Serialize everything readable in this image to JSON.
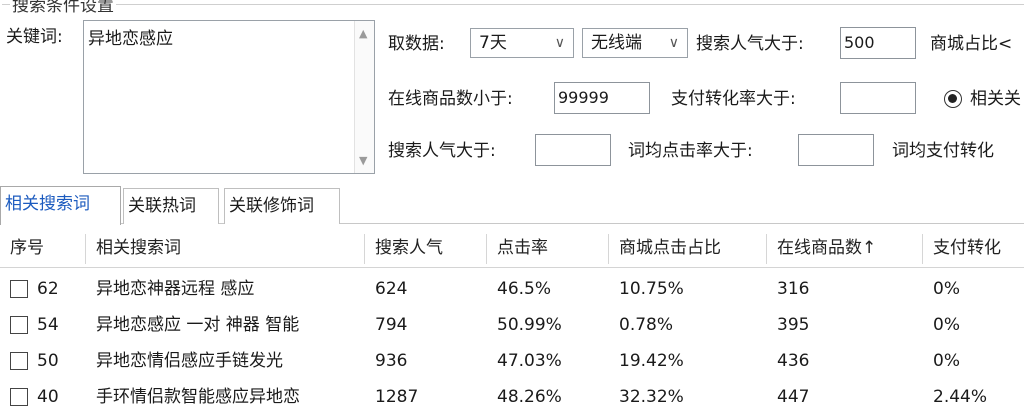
{
  "group_title": "搜索条件设置",
  "keyword": {
    "label": "关键词:",
    "value": "异地恋感应"
  },
  "filters": {
    "period_label": "取数据:",
    "period_value": "7天",
    "terminal_value": "无线端",
    "popularity_label": "搜索人气大于:",
    "popularity_value": "500",
    "mall_label": "商城占比<",
    "online_goods_label": "在线商品数小于:",
    "online_goods_value": "99999",
    "pay_rate_label": "支付转化率大于:",
    "pay_rate_value": "",
    "related_radio_label": "相关关",
    "popularity2_label": "搜索人气大于:",
    "popularity2_value": "",
    "avg_ctr_label": "词均点击率大于:",
    "avg_ctr_value": "",
    "avg_pay_label": "词均支付转化"
  },
  "tabs": [
    "相关搜索词",
    "关联热词",
    "关联修饰词"
  ],
  "table": {
    "headers": [
      "序号",
      "相关搜索词",
      "搜索人气",
      "点击率",
      "商城点击占比",
      "在线商品数↑",
      "支付转化"
    ],
    "rows": [
      {
        "idx": "62",
        "word": "异地恋神器远程 感应",
        "popularity": "624",
        "ctr": "46.5%",
        "mall_ctr": "10.75%",
        "online": "316",
        "pay": "0%"
      },
      {
        "idx": "54",
        "word": "异地恋感应 一对 神器 智能",
        "popularity": "794",
        "ctr": "50.99%",
        "mall_ctr": "0.78%",
        "online": "395",
        "pay": "0%"
      },
      {
        "idx": "50",
        "word": "异地恋情侣感应手链发光",
        "popularity": "936",
        "ctr": "47.03%",
        "mall_ctr": "19.42%",
        "online": "436",
        "pay": "0%"
      },
      {
        "idx": "40",
        "word": "手环情侣款智能感应异地恋",
        "popularity": "1287",
        "ctr": "48.26%",
        "mall_ctr": "32.32%",
        "online": "447",
        "pay": "2.44%"
      }
    ]
  }
}
